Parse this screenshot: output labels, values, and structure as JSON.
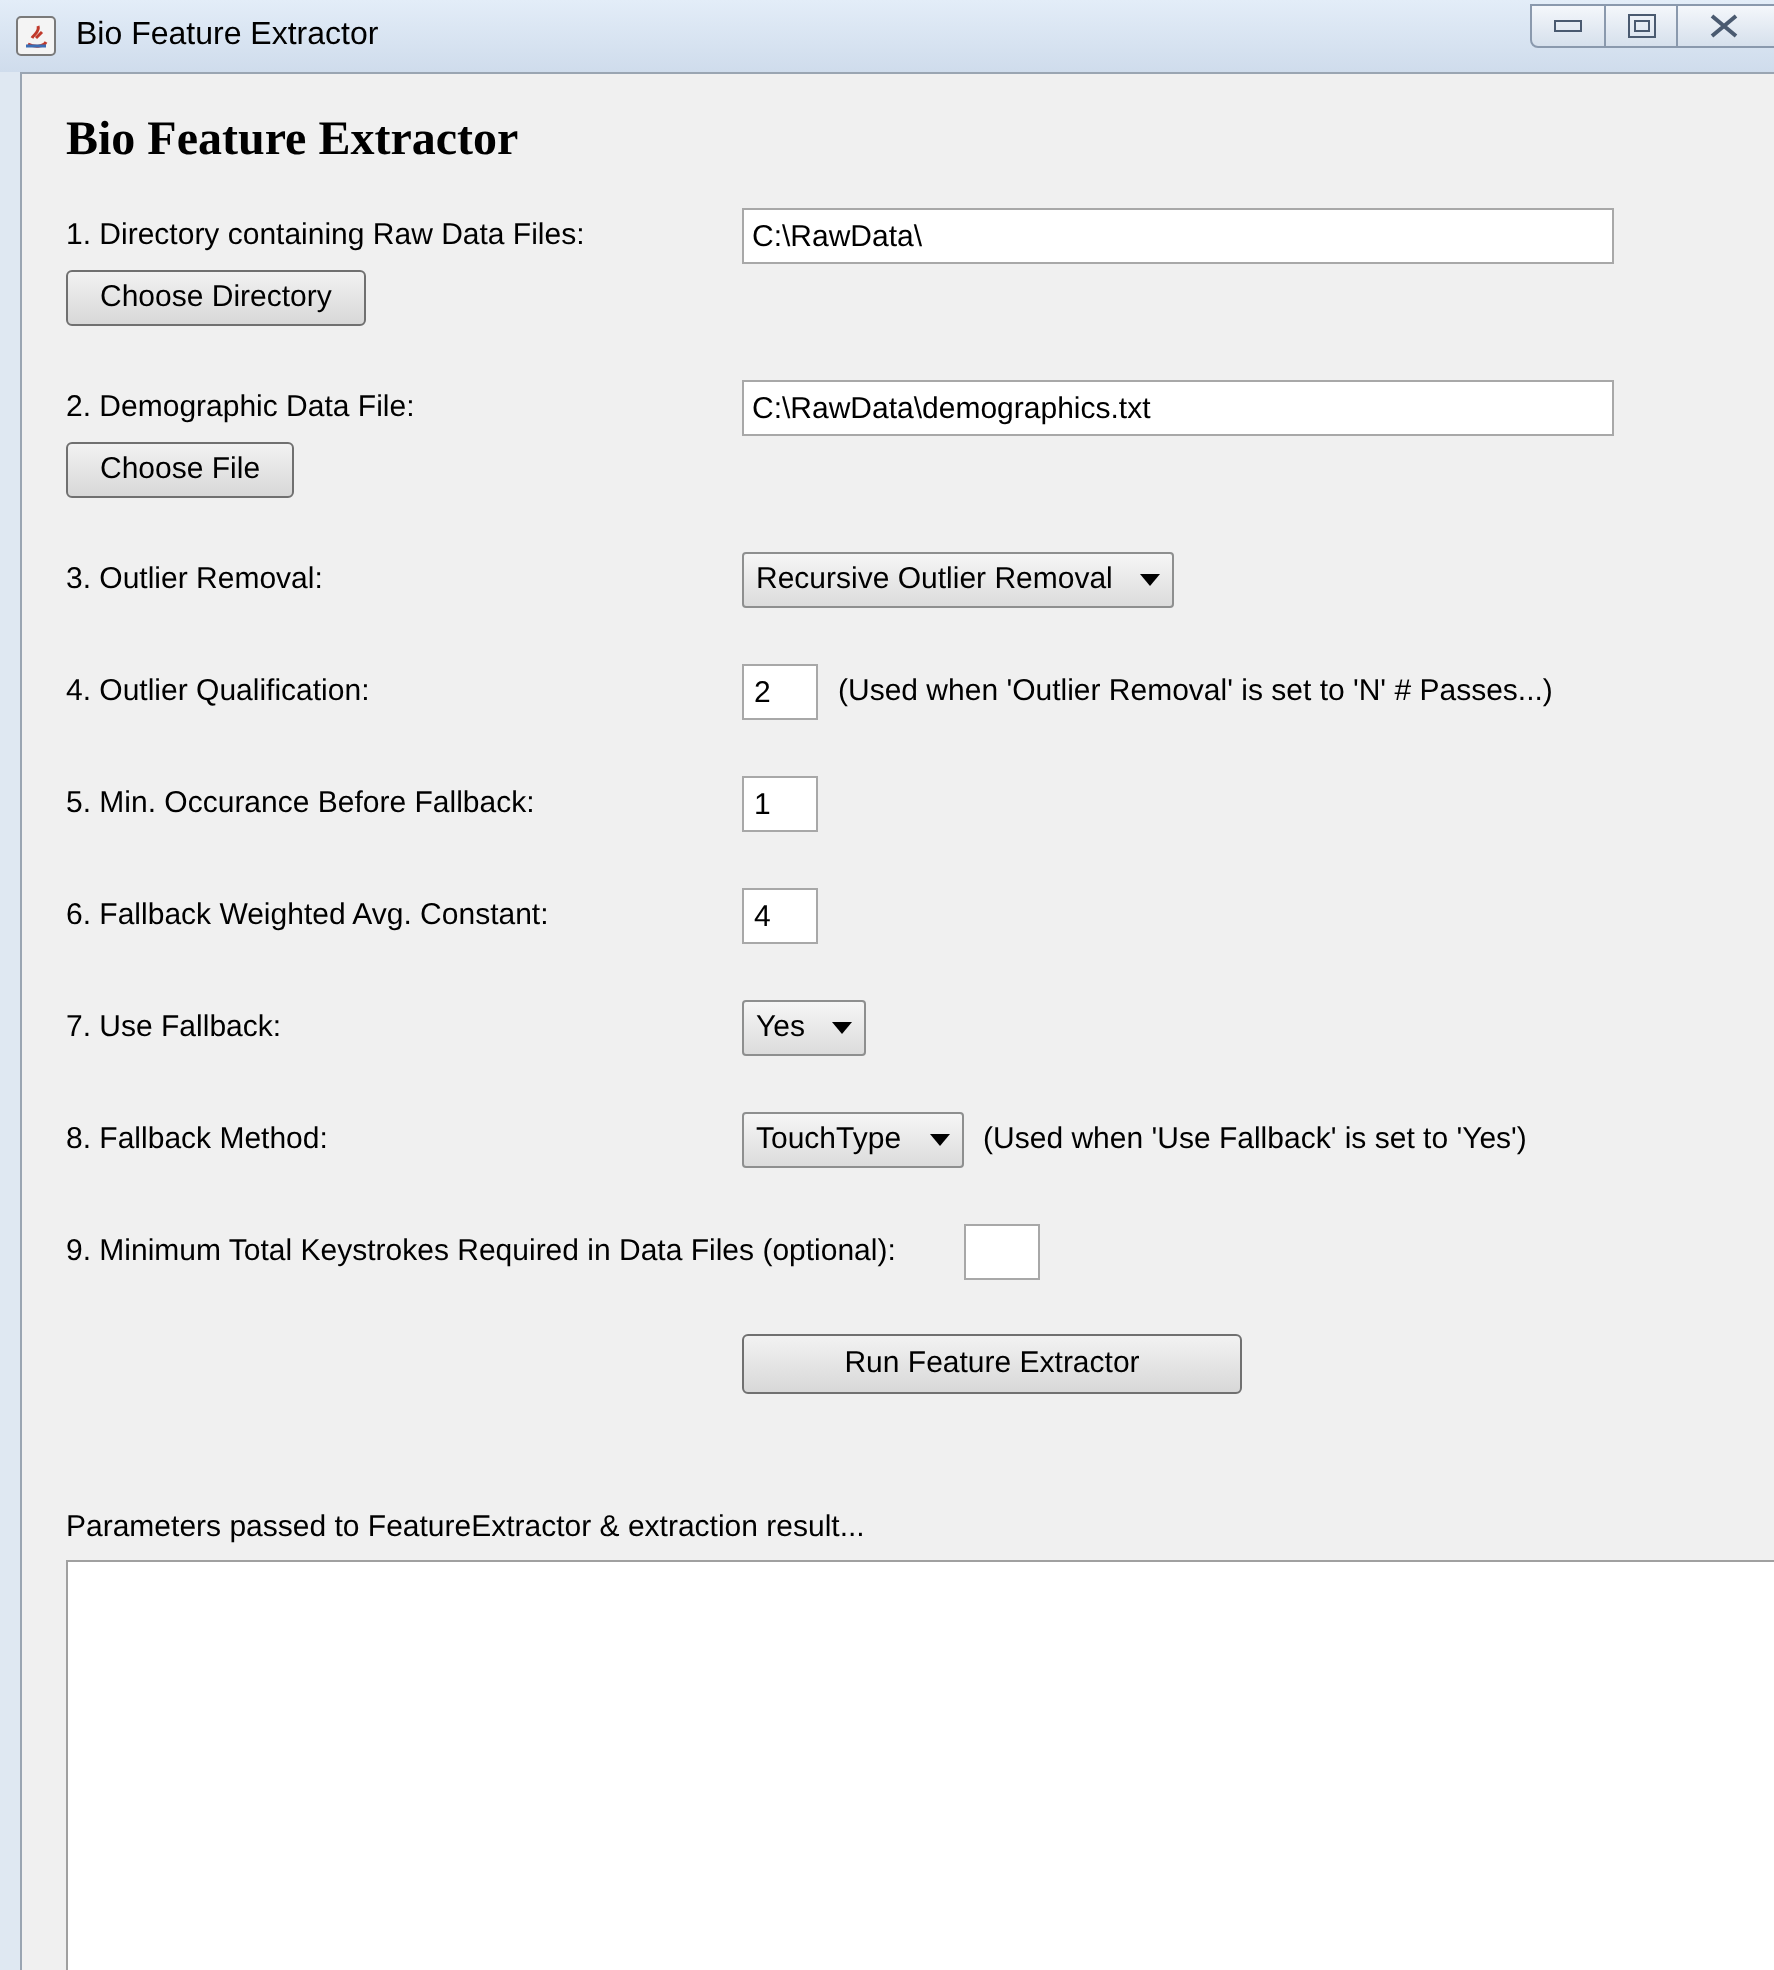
{
  "window": {
    "title": "Bio Feature Extractor"
  },
  "heading": "Bio Feature Extractor",
  "rows": [
    {
      "kind": "path",
      "label": "1. Directory containing Raw Data Files:",
      "value": "C:\\RawData\\",
      "button": "Choose Directory"
    },
    {
      "kind": "path",
      "label": "2. Demographic Data File:",
      "value": "C:\\RawData\\demographics.txt",
      "button": "Choose File"
    },
    {
      "kind": "select",
      "label": "3. Outlier Removal:",
      "value": "Recursive Outlier Removal"
    },
    {
      "kind": "number",
      "label": "4. Outlier Qualification:",
      "value": "2",
      "note": "(Used when 'Outlier Removal' is set to 'N' # Passes...)"
    },
    {
      "kind": "number",
      "label": "5. Min. Occurance Before Fallback:",
      "value": "1"
    },
    {
      "kind": "number",
      "label": "6. Fallback Weighted Avg. Constant:",
      "value": "4"
    },
    {
      "kind": "select",
      "label": "7. Use Fallback:",
      "value": "Yes"
    },
    {
      "kind": "select",
      "label": "8. Fallback Method:",
      "value": "TouchType",
      "note": "(Used when 'Use Fallback' is set to 'Yes')"
    },
    {
      "kind": "number",
      "label": "9. Minimum Total Keystrokes Required in Data Files (optional):"
    }
  ],
  "run_button": "Run Feature Extractor",
  "output": {
    "label": "Parameters passed to FeatureExtractor & extraction result..."
  }
}
